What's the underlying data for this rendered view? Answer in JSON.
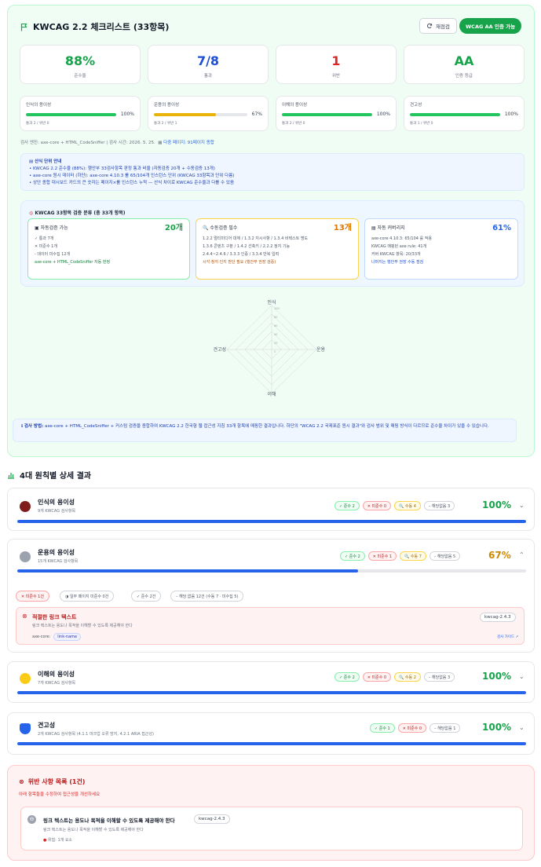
{
  "header": {
    "title": "KWCAG 2.2 체크리스트 (33항목)",
    "refresh": "재점검",
    "pass_badge": "WCAG AA 인증 가능"
  },
  "stats": [
    {
      "value": "88%",
      "label": "준수율",
      "color": "#16a34a"
    },
    {
      "value": "7/8",
      "label": "통과",
      "color": "#1d4ed8"
    },
    {
      "value": "1",
      "label": "위반",
      "color": "#dc2626"
    },
    {
      "value": "AA",
      "label": "인증 등급",
      "color": "#16a34a"
    }
  ],
  "principles": [
    {
      "name": "인식의 용이성",
      "pct": "100%",
      "level": 1.0,
      "color": "#16a34a",
      "sub": "통과 2 / 위반 0"
    },
    {
      "name": "운용의 용이성",
      "pct": "67%",
      "level": 0.67,
      "color": "#eab308",
      "sub": "통과 2 / 위반 1"
    },
    {
      "name": "이해의 용이성",
      "pct": "100%",
      "level": 1.0,
      "color": "#16a34a",
      "sub": "통과 2 / 위반 0"
    },
    {
      "name": "견고성",
      "pct": "100%",
      "level": 1.0,
      "color": "#16a34a",
      "sub": "통과 1 / 위반 0"
    }
  ],
  "meta": {
    "engine": "검사 엔진: axe-core + HTML_CodeSniffer",
    "sep": "|",
    "time": "검사 시간: 2026. 5. 25.",
    "pages": "다중 페이지: 91페이지 종합"
  },
  "note": {
    "title": "산식 단위 안내",
    "l1": "• KWCAG 2.2 준수율 (88%): 행안부 33검사항목 판정 통과 비율 (자동검증 20개 + 수동검증 13개)",
    "l2": "• axe-core 원시 데이터 (하단): axe-core 4.10.3 룰 65/104개 인스턴스 단위 (KWCAG 33항목과 단위 다름)",
    "l3": "• 상단 종합 대시보드 카드의 큰 숫자는 페이지×룰 인스턴스 누적 — 산식 차이로 KWCAG 준수율과 다를 수 있음"
  },
  "classification": {
    "title": "KWCAG 33항목 검증 분류 (총 33개 항목)",
    "auto": {
      "name": "자동검증 가능",
      "count": "20개",
      "lines": [
        "✓ 통과 7개",
        "✕ 미준수 1개",
        "- 데이터 미수집 12개"
      ],
      "foot": "axe-core + HTML_CodeSniffer 자동 판정"
    },
    "manual": {
      "name": "수동검증 필수",
      "count": "13개",
      "lines": [
        "1.2.2 멀티미디어 대체 / 1.3.2 지시사항 / 1.3.4 비텍스트 명도",
        "1.3.6 콘텐츠 구분 / 1.4.2 선축키 / 2.2.2 정지 기능",
        "2.4.4~2.4.6 / 3.3.3 인증 / 3.3.4 반복 입력"
      ],
      "foot": "시각·청각·인지 판단 필요 (행안부 권장 검증)"
    },
    "coverage": {
      "name": "자동 커버리지",
      "pct": "61%",
      "lines": [
        "axe-core 4.10.3: 65/104 룰 적용",
        "KWCAG 매핑된 axe rule: 41개",
        "커버 KWCAG 항목: 20/33개"
      ],
      "foot": "나머지는 행안부 권장 수동 점검"
    }
  },
  "radar": {
    "axes": [
      "인식",
      "운용",
      "이해",
      "견고성"
    ],
    "ticks": [
      "100",
      "80",
      "60",
      "40",
      "20",
      "0"
    ]
  },
  "info": {
    "title": "검사 방법:",
    "text": "axe-core + HTML_CodeSniffer + 커스텀 검증을 종합하여 KWCAG 2.2 한국형 웹 접근성 지침 33개 항목에 매핑한 결과입니다. 하단의 \"WCAG 2.2 국제표준 원시 결과\"와 검사 범위 및 매핑 방식이 다르므로 준수율 차이가 있을 수 있습니다."
  },
  "section_title": "4대 원칙별 상세 결과",
  "accordions": [
    {
      "name": "인식의 용이성",
      "sub": "9개 KWCAG 검사항목",
      "chips": [
        "✓ 준수 2",
        "✕ 미준수 0",
        "🔍 수동 4",
        "– 해당없음 3"
      ],
      "pct": "100%",
      "level": 1.0
    },
    {
      "name": "운용의 용이성",
      "sub": "15개 KWCAG 검사항목",
      "chips": [
        "✓ 준수 2",
        "✕ 미준수 1",
        "🔍 수동 7",
        "– 해당없음 5"
      ],
      "pct": "67%",
      "level": 0.67
    },
    {
      "name": "이해의 용이성",
      "sub": "7개 KWCAG 검사항목",
      "chips": [
        "✓ 준수 2",
        "✕ 미준수 0",
        "🔍 수동 2",
        "– 해당없음 3"
      ],
      "pct": "100%",
      "level": 1.0
    },
    {
      "name": "견고성",
      "sub": "2개 KWCAG 검사항목 (4.1.1 마크업 오류 방지, 4.2.1 ARIA 접근성)",
      "chips": [
        "✓ 준수 1",
        "✕ 미준수 0",
        "– 해당없음 1"
      ],
      "pct": "100%",
      "level": 1.0
    }
  ],
  "filters": [
    "✕ 미준수 1건",
    "◑ 일부 페이지 미준수 0건",
    "✓ 준수 2건",
    "– 해당 없음 12건 (수동 7 · 미수집 5)"
  ],
  "expanded_violation": {
    "title": "적절한 링크 텍스트",
    "code": "kwcag-2.4.3",
    "desc": "링크 텍스트는 용도나 목적을 이해할 수 있도록 제공해야 한다",
    "axe_label": "axe-core:",
    "rule": "link-name",
    "guide": "검사 가이드 ↗"
  },
  "violations": {
    "title": "위반 사항 목록 (1건)",
    "sub": "아래 항목들을 수정하여 접근성을 개선하세요",
    "item": {
      "title": "링크 텍스트는 용도나 목적을 이해할 수 있도록 제공해야 한다",
      "code": "kwcag-2.4.3",
      "desc": "링크 텍스트는 용도나 목적을 이해할 수 있도록 제공해야 한다",
      "loc": "위험: 1개 요소"
    }
  }
}
